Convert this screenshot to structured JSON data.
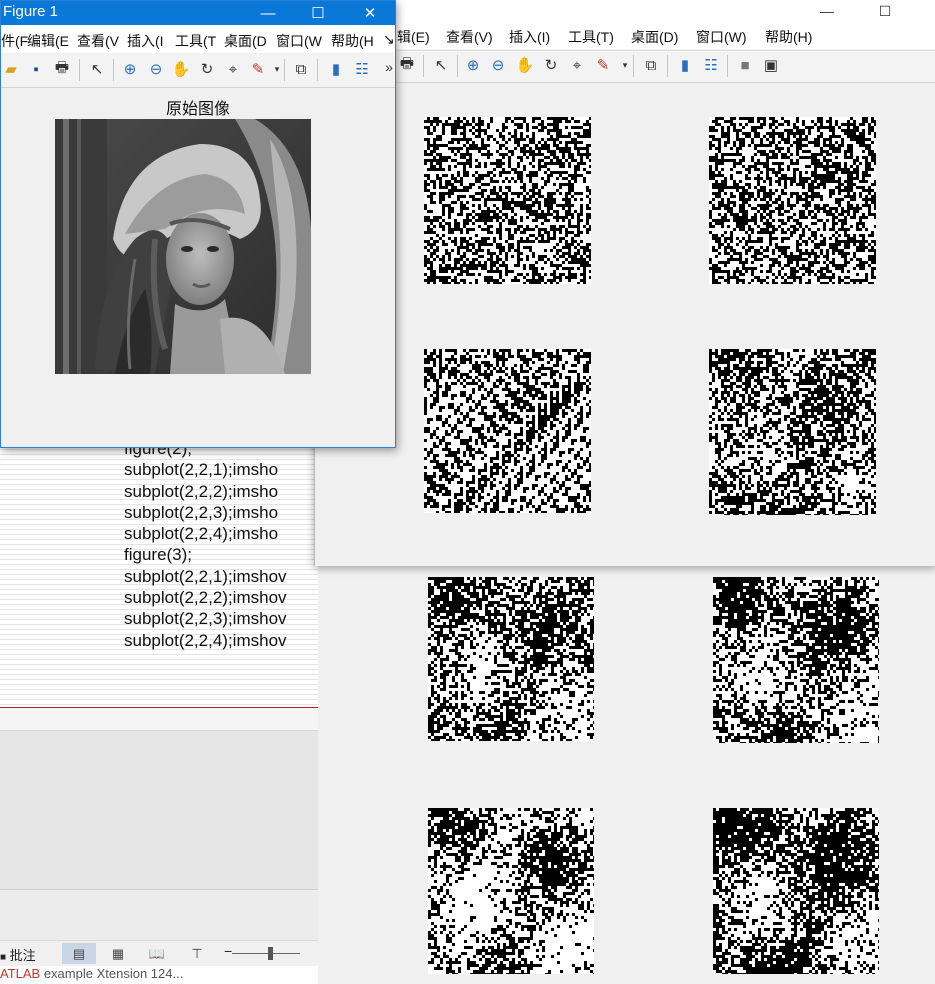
{
  "editor": {
    "code_lines": [
      "figure(2);",
      "subplot(2,2,1);imsho",
      "subplot(2,2,2);imsho",
      "subplot(2,2,3);imsho",
      "subplot(2,2,4);imsho",
      "figure(3);",
      "subplot(2,2,1);imshov",
      "subplot(2,2,2);imshov",
      "subplot(2,2,3);imshov",
      "subplot(2,2,4);imshov"
    ],
    "status": {
      "notes_label": "批注"
    },
    "footer": {
      "red_text": "ATLAB",
      "rest_text": " example Xtension 124..."
    }
  },
  "figure1": {
    "title": "Figure 1",
    "menu": [
      "件(F",
      "编辑(E",
      "查看(V",
      "插入(I",
      "工具(T",
      "桌面(D",
      "窗口(W",
      "帮助(H"
    ],
    "more": "»",
    "axes_title": "原始图像"
  },
  "figure2": {
    "menu": [
      "辑(E)",
      "查看(V)",
      "插入(I)",
      "工具(T)",
      "桌面(D)",
      "窗口(W)",
      "帮助(H)"
    ]
  },
  "colors": {
    "titlebar_blue": "#0a78d7",
    "accent_red": "#b0202a"
  }
}
